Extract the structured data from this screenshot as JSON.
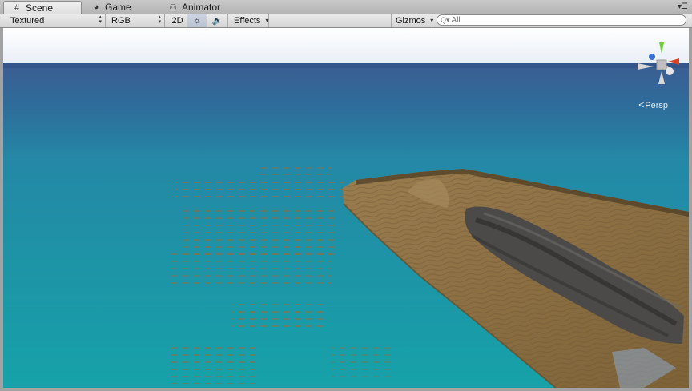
{
  "tabs": [
    {
      "label": "Scene",
      "icon": "grid-icon",
      "active": true
    },
    {
      "label": "Game",
      "icon": "pacman-icon",
      "active": false
    },
    {
      "label": "Animator",
      "icon": "animator-icon",
      "active": false
    }
  ],
  "toolbar": {
    "draw_mode": "Textured",
    "render_mode": "RGB",
    "mode_2d_label": "2D",
    "lighting_icon": "sun-icon",
    "audio_icon": "speaker-icon",
    "effects_label": "Effects",
    "gizmos_label": "Gizmos",
    "search_placeholder": "All"
  },
  "viewport": {
    "projection_label": "Persp",
    "colors": {
      "sky": "#f2f6fb",
      "sea_far": "#3a5f94",
      "sea_near": "#1a9aa5",
      "sand": "#8c6f43",
      "rock": "#4a4a4a",
      "gizmo_y": "#6cd13a",
      "gizmo_x": "#e0401e",
      "gizmo_z": "#3a6fd6"
    }
  }
}
